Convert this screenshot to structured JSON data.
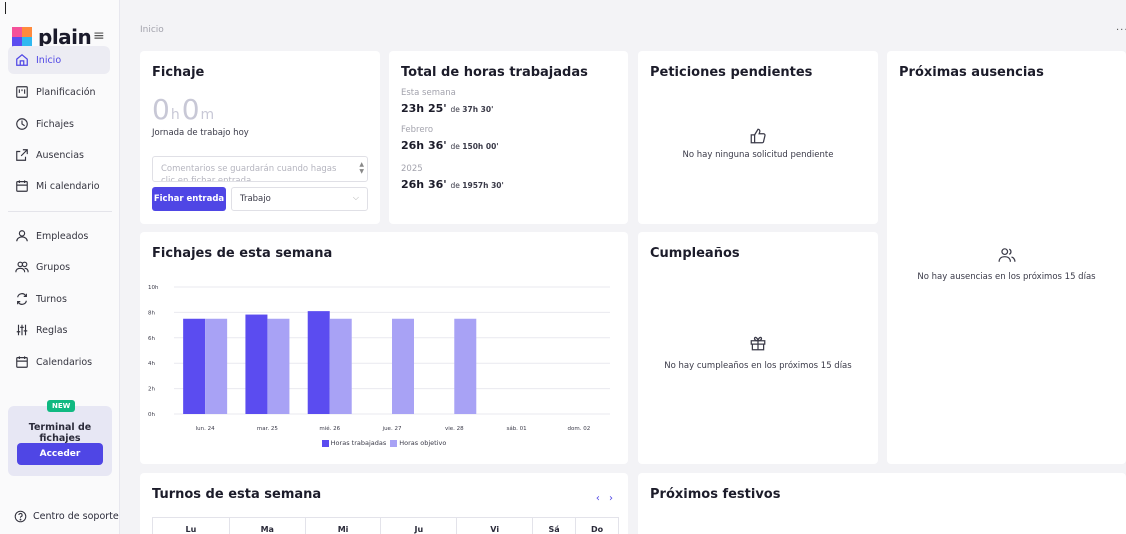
{
  "brand": {
    "name": "plain",
    "colors": {
      "accent": "#4f46e5",
      "bar_worked": "#5b4cf0",
      "bar_target": "#a8a2f5",
      "new_badge": "#10b981"
    }
  },
  "sidebar": {
    "items": [
      {
        "label": "Inicio",
        "icon": "home-icon",
        "active": true
      },
      {
        "label": "Planificación",
        "icon": "planning-icon"
      },
      {
        "label": "Fichajes",
        "icon": "clock-icon"
      },
      {
        "label": "Ausencias",
        "icon": "external-link-icon"
      },
      {
        "label": "Mi calendario",
        "icon": "calendar-icon"
      },
      {
        "label": "Empleados",
        "icon": "user-icon"
      },
      {
        "label": "Grupos",
        "icon": "users-icon"
      },
      {
        "label": "Turnos",
        "icon": "refresh-icon"
      },
      {
        "label": "Reglas",
        "icon": "sliders-icon"
      },
      {
        "label": "Calendarios",
        "icon": "calendar-icon"
      }
    ],
    "terminal": {
      "badge": "NEW",
      "title": "Terminal de fichajes",
      "button": "Acceder"
    },
    "support": "Centro de soporte"
  },
  "header": {
    "breadcrumb": "Inicio",
    "more": "..."
  },
  "fichaje": {
    "title": "Fichaje",
    "timer": {
      "hours": "0",
      "h_unit": "h",
      "minutes": "0",
      "m_unit": "m"
    },
    "subtitle": "Jornada de trabajo hoy",
    "comment_placeholder": "Comentarios se guardarán cuando hagas clic en fichar entrada",
    "button": "Fichar entrada",
    "select_value": "Trabajo"
  },
  "hours": {
    "title": "Total de horas trabajadas",
    "periods": [
      {
        "label": "Esta semana",
        "worked": "23h 25'",
        "of": "de",
        "target": "37h 30'"
      },
      {
        "label": "Febrero",
        "worked": "26h 36'",
        "of": "de",
        "target": "150h 00'"
      },
      {
        "label": "2025",
        "worked": "26h 36'",
        "of": "de",
        "target": "1957h 30'"
      }
    ]
  },
  "peticiones": {
    "title": "Peticiones pendientes",
    "empty": "No hay ninguna solicitud pendiente"
  },
  "ausencias": {
    "title": "Próximas ausencias",
    "empty": "No hay ausencias en los próximos 15 días"
  },
  "cumpleanos": {
    "title": "Cumpleaños",
    "empty": "No hay cumpleaños en los próximos 15 días"
  },
  "weekly": {
    "title": "Fichajes de esta semana"
  },
  "chart_data": {
    "type": "bar",
    "categories": [
      "lun. 24",
      "mar. 25",
      "mié. 26",
      "jue. 27",
      "vie. 28",
      "sáb. 01",
      "dom. 02"
    ],
    "series": [
      {
        "name": "Horas trabajadas",
        "values": [
          7.5,
          7.83,
          8.1,
          0,
          0,
          0,
          0
        ]
      },
      {
        "name": "Horas objetivo",
        "values": [
          7.5,
          7.5,
          7.5,
          7.5,
          7.5,
          0,
          0
        ]
      }
    ],
    "yticks": [
      "0h",
      "2h",
      "4h",
      "6h",
      "8h",
      "10h"
    ],
    "ylim": [
      0,
      10
    ],
    "grid": true,
    "legend_position": "bottom"
  },
  "turnos": {
    "title": "Turnos de esta semana",
    "nav": "‹ ›",
    "days": [
      "Lu",
      "Ma",
      "Mi",
      "Ju",
      "Vi",
      "Sá",
      "Do"
    ]
  },
  "festivos": {
    "title": "Próximos festivos"
  }
}
